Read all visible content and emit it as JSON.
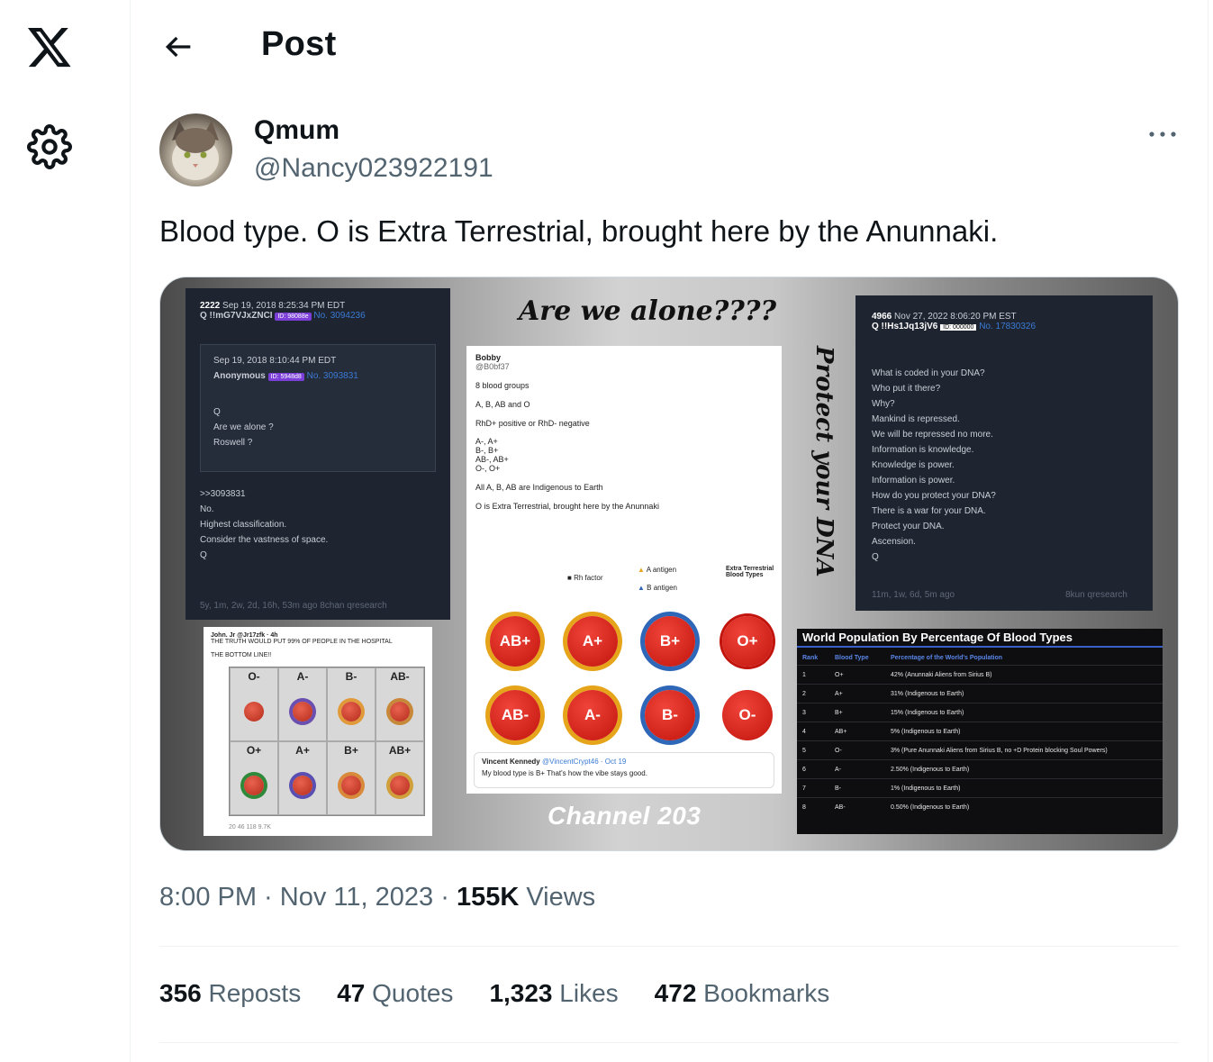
{
  "nav": {
    "logo_icon": "x-logo-icon",
    "settings_icon": "gear-icon"
  },
  "header": {
    "title": "Post",
    "back_icon": "arrow-left-icon"
  },
  "post": {
    "display_name": "Qmum",
    "handle": "@Nancy023922191",
    "text": "Blood type. O is Extra Terrestrial, brought here by the Anunnaki.",
    "more_icon": "more-horizontal-icon",
    "meta": {
      "time": "8:00 PM",
      "sep1": " · ",
      "date": "Nov 11, 2023",
      "sep2": " · ",
      "views_count": "155K",
      "views_label": " Views"
    },
    "stats": [
      {
        "count": "356",
        "label": " Reposts"
      },
      {
        "count": "47",
        "label": " Quotes"
      },
      {
        "count": "1,323",
        "label": " Likes"
      },
      {
        "count": "472",
        "label": " Bookmarks"
      }
    ]
  },
  "image": {
    "heading": "Are we alone????",
    "side_text": "Protect your DNA",
    "footer": "Channel 203",
    "q_left": {
      "num": "2222",
      "date": "Sep 19, 2018 8:25:34 PM EDT",
      "trip": "Q !!mG7VJxZNCI",
      "id": "ID: 98088e",
      "no": "No. 3094236",
      "inner_date": "Sep 19, 2018 8:10:44 PM EDT",
      "inner_name": "Anonymous",
      "inner_id": "ID: 5948d8",
      "inner_no": "No. 3093831",
      "inner_lines": [
        "Q",
        "Are we alone ?",
        "Roswell ?"
      ],
      "lines": [
        ">>3093831",
        "No.",
        "Highest classification.",
        "Consider the vastness of space.",
        "Q"
      ],
      "foot": "5y, 1m, 2w, 2d, 16h, 53m ago       8chan qresearch"
    },
    "small_tweet": {
      "author": "John. Jr @Jr17zfk · 4h",
      "line1": "THE TRUTH WOULD PUT 99% OF PEOPLE IN THE HOSPITAL",
      "line2": "THE BOTTOM LINE!!",
      "types": [
        "O-",
        "A-",
        "B-",
        "AB-",
        "O+",
        "A+",
        "B+",
        "AB+"
      ],
      "actions": "20     46     118     9.7K"
    },
    "center_tweet": {
      "author": "Bobby",
      "handle": "@B0bf37",
      "lines": [
        "8 blood groups",
        "A, B, AB and O",
        "RhD+ positive or RhD- negative",
        "A-, A+",
        "B-, B+",
        "AB-, AB+",
        "O-, O+",
        "All A, B, AB are Indigenous to Earth",
        "O is Extra Terrestrial, brought here by the Anunnaki"
      ],
      "legend": {
        "rh": "Rh factor",
        "a": "A antigen",
        "b": "B antigen",
        "extra": "Extra Terrestrial Blood Types",
        "extra_types": "O-   O+"
      },
      "row1": [
        "AB+",
        "A+",
        "B+",
        "O+"
      ],
      "row2": [
        "AB-",
        "A-",
        "B-",
        "O-"
      ],
      "reply_author": "Vincent Kennedy",
      "reply_handle": "@VincentCrypt46 · Oct 19",
      "reply_text": "My blood type is B+ That's how the vibe stays good."
    },
    "q_right": {
      "num": "4966",
      "date": "Nov 27, 2022 8:06:20 PM EST",
      "trip": "Q !!Hs1Jq13jV6",
      "id": "ID: 000000",
      "no": "No. 17830326",
      "lines": [
        "What is coded in your DNA?",
        "Who put it there?",
        "Why?",
        "Mankind is repressed.",
        "We will be repressed no more.",
        "Information is knowledge.",
        "Knowledge is power.",
        "Information is power.",
        "How do you protect your DNA?",
        "There is a war for your DNA.",
        "Protect your DNA.",
        "Ascension.",
        "Q"
      ],
      "foot": "11m, 1w, 6d, 5m ago",
      "foot2": "8kun qresearch"
    },
    "table": {
      "title": "World Population By Percentage Of Blood Types",
      "headers": [
        "Rank",
        "Blood Type",
        "Percentage of the World's Population"
      ],
      "rows": [
        [
          "1",
          "O+",
          "42% (Anunnaki Aliens from Sirius B)"
        ],
        [
          "2",
          "A+",
          "31% (Indigenous to Earth)"
        ],
        [
          "3",
          "B+",
          "15% (Indigenous to Earth)"
        ],
        [
          "4",
          "AB+",
          "5% (Indigenous to Earth)"
        ],
        [
          "5",
          "O-",
          "3% (Pure Anunnaki Aliens from Sirius B, no +D Protein blocking Soul Powers)"
        ],
        [
          "6",
          "A-",
          "2.50% (Indigenous to Earth)"
        ],
        [
          "7",
          "B-",
          "1% (Indigenous to Earth)"
        ],
        [
          "8",
          "AB-",
          "0.50% (Indigenous to Earth)"
        ]
      ]
    }
  }
}
